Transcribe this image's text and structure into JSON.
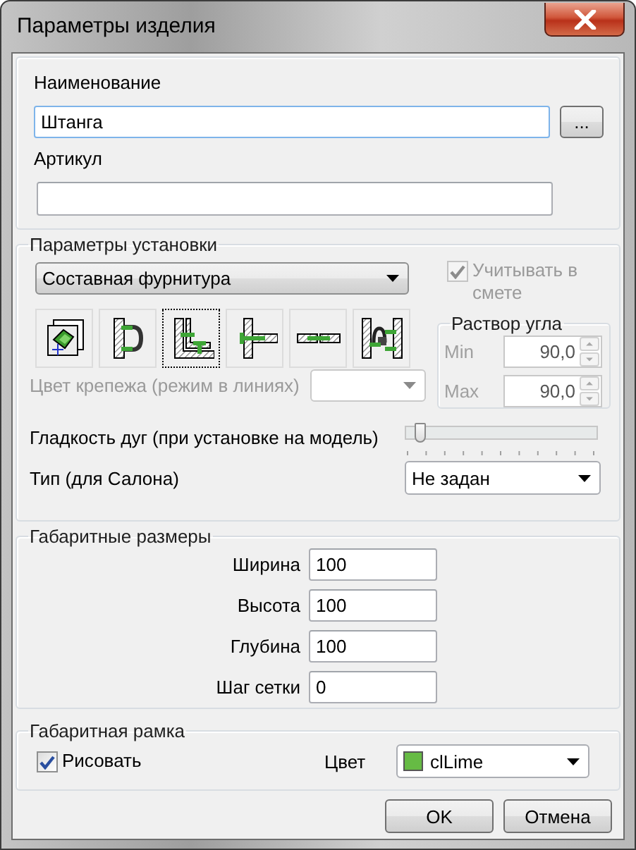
{
  "window": {
    "title": "Параметры изделия"
  },
  "product": {
    "name_label": "Наименование",
    "name_value": "Штанга",
    "browse_button": "...",
    "article_label": "Артикул"
  },
  "installation": {
    "title": "Параметры установки",
    "fitting_type": "Составная фурнитура",
    "include_in_estimate": {
      "label": "Учитывать в смете",
      "checked": true,
      "disabled": true
    },
    "joint_types": [
      {
        "kind": "cube",
        "selected": false
      },
      {
        "kind": "bracket",
        "selected": false
      },
      {
        "kind": "corner",
        "selected": true
      },
      {
        "kind": "tee",
        "selected": false
      },
      {
        "kind": "inline",
        "selected": false
      },
      {
        "kind": "double",
        "selected": false
      }
    ],
    "angle": {
      "title": "Раствор угла",
      "min": {
        "label": "Min",
        "value": "90,0",
        "disabled": true
      },
      "max": {
        "label": "Max",
        "value": "90,0",
        "disabled": true
      }
    },
    "fastener_color": {
      "label": "Цвет крепежа (режим в линиях)",
      "disabled": true
    },
    "arc_smoothness": {
      "label": "Гладкость дуг (при установке на модель)",
      "level": 0.05
    },
    "salon_type": {
      "label": "Тип (для Салона)",
      "value": "Не задан"
    }
  },
  "dimensions": {
    "title": "Габаритные размеры",
    "rows": [
      {
        "label": "Ширина",
        "value": "100"
      },
      {
        "label": "Высота",
        "value": "100"
      },
      {
        "label": "Глубина",
        "value": "100"
      },
      {
        "label": "Шаг сетки",
        "value": "0"
      }
    ]
  },
  "bounding_frame": {
    "title": "Габаритная рамка",
    "draw": {
      "label": "Рисовать",
      "checked": true
    },
    "color_label": "Цвет",
    "color": {
      "name": "clLime",
      "color": "#66bb44"
    }
  },
  "buttons": [
    "OK",
    "Отмена"
  ]
}
